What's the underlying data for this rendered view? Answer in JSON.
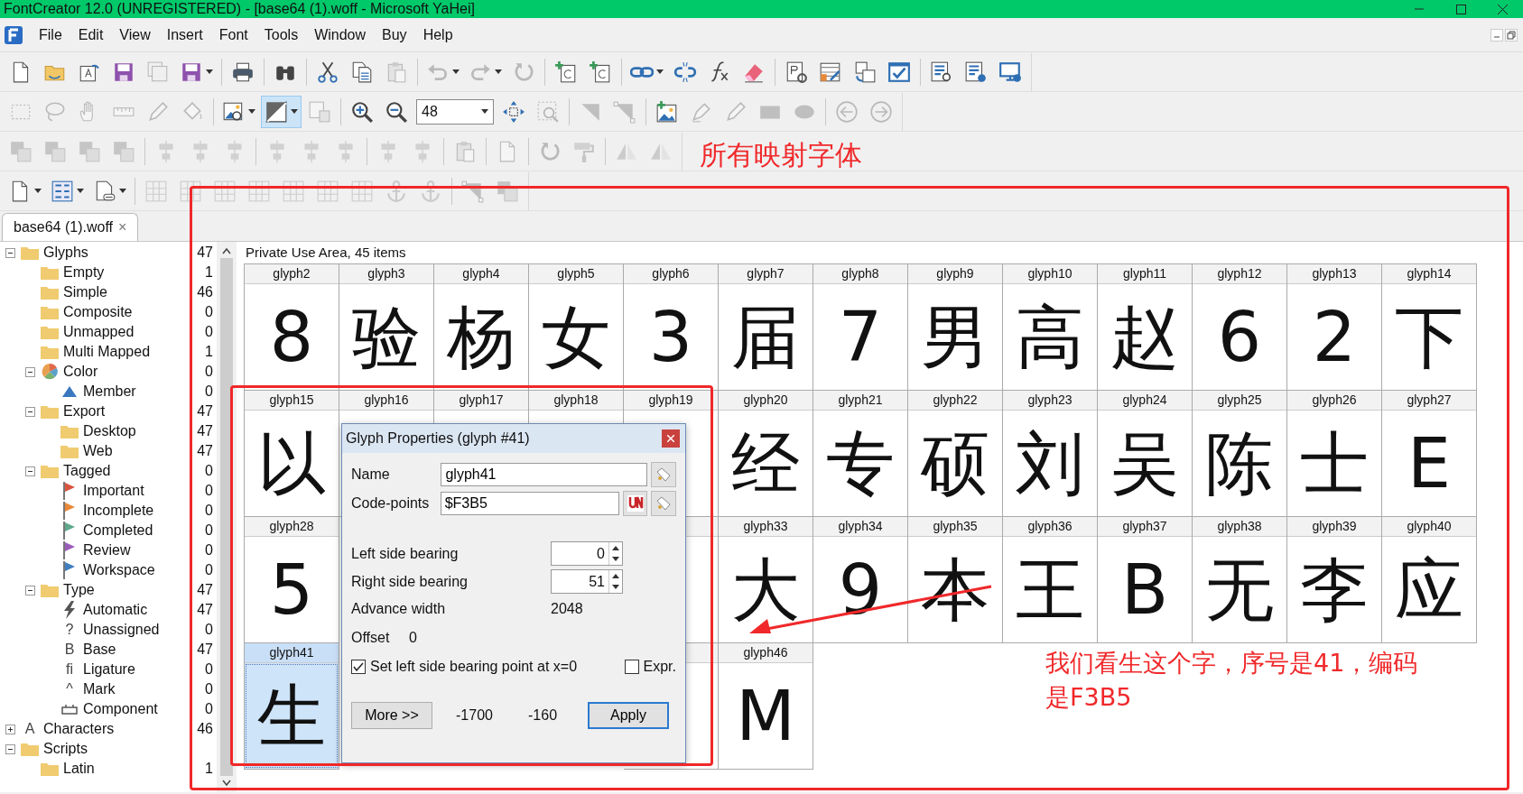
{
  "window": {
    "title": "FontCreator 12.0 (UNREGISTERED) - [base64 (1).woff - Microsoft YaHei]"
  },
  "menu": [
    "File",
    "Edit",
    "View",
    "Insert",
    "Font",
    "Tools",
    "Window",
    "Buy",
    "Help"
  ],
  "toolbars": [
    [
      {
        "kind": "page",
        "disabled": false
      },
      {
        "kind": "folder",
        "disabled": false
      },
      {
        "kind": "preview",
        "disabled": false
      },
      {
        "kind": "floppy",
        "disabled": false
      },
      {
        "kind": "floppies",
        "disabled": true
      },
      {
        "kind": "floppy",
        "disabled": false,
        "dropdown": true
      },
      {
        "kind": "sep"
      },
      {
        "kind": "printer",
        "disabled": false
      },
      {
        "kind": "sep"
      },
      {
        "kind": "binoculars",
        "disabled": false
      },
      {
        "kind": "sep"
      },
      {
        "kind": "scissors",
        "disabled": false
      },
      {
        "kind": "pages",
        "disabled": false
      },
      {
        "kind": "clipboard",
        "disabled": true
      },
      {
        "kind": "sep"
      },
      {
        "kind": "undo",
        "disabled": true,
        "dropdown": true
      },
      {
        "kind": "redo",
        "disabled": true,
        "dropdown": true
      },
      {
        "kind": "reload",
        "disabled": true
      },
      {
        "kind": "sep"
      },
      {
        "kind": "page-plus",
        "disabled": false
      },
      {
        "kind": "page-plus",
        "disabled": false
      },
      {
        "kind": "sep"
      },
      {
        "kind": "chain",
        "disabled": false,
        "dropdown": true
      },
      {
        "kind": "broken-chain",
        "disabled": false
      },
      {
        "kind": "curve",
        "disabled": false
      },
      {
        "kind": "eraser",
        "disabled": false
      },
      {
        "kind": "sep"
      },
      {
        "kind": "page-gear",
        "disabled": false
      },
      {
        "kind": "table-pen",
        "disabled": false
      },
      {
        "kind": "pages-swap",
        "disabled": false
      },
      {
        "kind": "check-window",
        "disabled": false
      },
      {
        "kind": "sep"
      },
      {
        "kind": "doc-lens",
        "disabled": false
      },
      {
        "kind": "doc-globe",
        "disabled": false
      },
      {
        "kind": "monitor",
        "disabled": false
      }
    ],
    [
      {
        "kind": "dashed-rect",
        "disabled": true
      },
      {
        "kind": "lasso",
        "disabled": true
      },
      {
        "kind": "hand",
        "disabled": true
      },
      {
        "kind": "ruler",
        "disabled": true
      },
      {
        "kind": "pencil",
        "disabled": true
      },
      {
        "kind": "bucket",
        "disabled": true
      },
      {
        "kind": "sep"
      },
      {
        "kind": "picture-lens",
        "disabled": false,
        "dropdown": true
      },
      {
        "kind": "contour",
        "disabled": false,
        "dropdown": true,
        "selected": true
      },
      {
        "kind": "shape",
        "disabled": true
      },
      {
        "kind": "sep"
      },
      {
        "kind": "zoom-in",
        "disabled": false
      },
      {
        "kind": "zoom-out",
        "disabled": false
      },
      {
        "kind": "combo",
        "value": "48"
      },
      {
        "kind": "fit",
        "disabled": false
      },
      {
        "kind": "zoom-area",
        "disabled": true
      },
      {
        "kind": "sep"
      },
      {
        "kind": "corner",
        "disabled": true
      },
      {
        "kind": "node",
        "disabled": true
      },
      {
        "kind": "sep"
      },
      {
        "kind": "picture-plus",
        "disabled": false
      },
      {
        "kind": "pen",
        "disabled": true
      },
      {
        "kind": "pencil",
        "disabled": true
      },
      {
        "kind": "rect-shape",
        "disabled": true
      },
      {
        "kind": "ellipse-shape",
        "disabled": true
      },
      {
        "kind": "sep"
      },
      {
        "kind": "arrow-left",
        "disabled": true
      },
      {
        "kind": "arrow-right",
        "disabled": true
      }
    ],
    [
      {
        "kind": "squares",
        "disabled": true
      },
      {
        "kind": "squares",
        "disabled": true
      },
      {
        "kind": "squares",
        "disabled": true
      },
      {
        "kind": "squares",
        "disabled": true
      },
      {
        "kind": "sep"
      },
      {
        "kind": "align",
        "disabled": true
      },
      {
        "kind": "align",
        "disabled": true
      },
      {
        "kind": "align",
        "disabled": true
      },
      {
        "kind": "sep"
      },
      {
        "kind": "align",
        "disabled": true
      },
      {
        "kind": "align",
        "disabled": true
      },
      {
        "kind": "align",
        "disabled": true
      },
      {
        "kind": "sep"
      },
      {
        "kind": "align",
        "disabled": true
      },
      {
        "kind": "align",
        "disabled": true
      },
      {
        "kind": "sep"
      },
      {
        "kind": "clipboard",
        "disabled": true
      },
      {
        "kind": "sep"
      },
      {
        "kind": "page",
        "disabled": true
      },
      {
        "kind": "sep"
      },
      {
        "kind": "reload",
        "disabled": true
      },
      {
        "kind": "roller",
        "disabled": true
      },
      {
        "kind": "sep"
      },
      {
        "kind": "mirror",
        "disabled": true
      },
      {
        "kind": "mirror",
        "disabled": true
      }
    ],
    [
      {
        "kind": "page",
        "disabled": false,
        "dropdown": true
      },
      {
        "kind": "sort",
        "disabled": false,
        "dropdown": true
      },
      {
        "kind": "page-list",
        "disabled": false,
        "dropdown": true
      },
      {
        "kind": "sep"
      },
      {
        "kind": "grid",
        "disabled": true
      },
      {
        "kind": "grid",
        "disabled": true
      },
      {
        "kind": "grid",
        "disabled": true
      },
      {
        "kind": "grid",
        "disabled": true
      },
      {
        "kind": "grid",
        "disabled": true
      },
      {
        "kind": "grid",
        "disabled": true
      },
      {
        "kind": "grid",
        "disabled": true
      },
      {
        "kind": "anchor",
        "disabled": true
      },
      {
        "kind": "anchor",
        "disabled": true
      },
      {
        "kind": "sep"
      },
      {
        "kind": "node",
        "disabled": true
      },
      {
        "kind": "squares",
        "disabled": true
      }
    ]
  ],
  "document_tab": {
    "label": "base64 (1).woff",
    "close": "×"
  },
  "tree": [
    {
      "label": "Glyphs",
      "count": "47",
      "kind": "folder",
      "expanded": true,
      "children": [
        {
          "label": "Empty",
          "count": "1",
          "kind": "folder"
        },
        {
          "label": "Simple",
          "count": "46",
          "kind": "folder"
        },
        {
          "label": "Composite",
          "count": "0",
          "kind": "folder"
        },
        {
          "label": "Unmapped",
          "count": "0",
          "kind": "folder"
        },
        {
          "label": "Multi Mapped",
          "count": "1",
          "kind": "folder"
        },
        {
          "label": "Color",
          "count": "0",
          "kind": "palette",
          "expanded": true,
          "children": [
            {
              "label": "Member",
              "count": "0",
              "kind": "triangle"
            }
          ]
        },
        {
          "label": "Export",
          "count": "47",
          "kind": "folder",
          "expanded": true,
          "children": [
            {
              "label": "Desktop",
              "count": "47",
              "kind": "folder"
            },
            {
              "label": "Web",
              "count": "47",
              "kind": "folder"
            }
          ]
        },
        {
          "label": "Tagged",
          "count": "0",
          "kind": "folder",
          "expanded": true,
          "children": [
            {
              "label": "Important",
              "count": "0",
              "kind": "flag",
              "color": "#d9553f"
            },
            {
              "label": "Incomplete",
              "count": "0",
              "kind": "flag",
              "color": "#e8893a"
            },
            {
              "label": "Completed",
              "count": "0",
              "kind": "flag",
              "color": "#5fa88c"
            },
            {
              "label": "Review",
              "count": "0",
              "kind": "flag",
              "color": "#9b5cb8"
            },
            {
              "label": "Workspace",
              "count": "0",
              "kind": "flag",
              "color": "#3f7fc0"
            }
          ]
        },
        {
          "label": "Type",
          "count": "47",
          "kind": "folder",
          "expanded": true,
          "children": [
            {
              "label": "Automatic",
              "count": "47",
              "kind": "bolt"
            },
            {
              "label": "Unassigned",
              "count": "0",
              "kind": "char",
              "icon_text": "?"
            },
            {
              "label": "Base",
              "count": "47",
              "kind": "char",
              "icon_text": "B"
            },
            {
              "label": "Ligature",
              "count": "0",
              "kind": "char",
              "icon_text": "fi"
            },
            {
              "label": "Mark",
              "count": "0",
              "kind": "char",
              "icon_text": "^"
            },
            {
              "label": "Component",
              "count": "0",
              "kind": "component"
            }
          ]
        }
      ]
    },
    {
      "label": "Characters",
      "count": "46",
      "kind": "char",
      "icon_text": "A",
      "expanded": false
    },
    {
      "label": "Scripts",
      "kind": "folder",
      "expanded": true,
      "children": [
        {
          "label": "Latin",
          "count": "1",
          "kind": "folder"
        }
      ]
    }
  ],
  "grid": {
    "title": "Private Use Area, 45 items",
    "cells": [
      {
        "label": "glyph2",
        "glyph": "8",
        "selected": false
      },
      {
        "label": "glyph3",
        "glyph": "验",
        "selected": false
      },
      {
        "label": "glyph4",
        "glyph": "杨",
        "selected": false
      },
      {
        "label": "glyph5",
        "glyph": "女",
        "selected": false
      },
      {
        "label": "glyph6",
        "glyph": "3",
        "selected": false
      },
      {
        "label": "glyph7",
        "glyph": "届",
        "selected": false
      },
      {
        "label": "glyph8",
        "glyph": "7",
        "selected": false
      },
      {
        "label": "glyph9",
        "glyph": "男",
        "selected": false
      },
      {
        "label": "glyph10",
        "glyph": "高",
        "selected": false
      },
      {
        "label": "glyph11",
        "glyph": "赵",
        "selected": false
      },
      {
        "label": "glyph12",
        "glyph": "6",
        "selected": false
      },
      {
        "label": "glyph13",
        "glyph": "2",
        "selected": false
      },
      {
        "label": "glyph14",
        "glyph": "下",
        "selected": false
      },
      {
        "label": "glyph15",
        "glyph": "以",
        "selected": false
      },
      {
        "label": "glyph16",
        "selected": false
      },
      {
        "label": "glyph17",
        "selected": false
      },
      {
        "label": "glyph18",
        "selected": false
      },
      {
        "label": "glyph19",
        "selected": false
      },
      {
        "label": "glyph20",
        "glyph": "经",
        "selected": false
      },
      {
        "label": "glyph21",
        "glyph": "专",
        "selected": false
      },
      {
        "label": "glyph22",
        "glyph": "硕",
        "selected": false
      },
      {
        "label": "glyph23",
        "glyph": "刘",
        "selected": false
      },
      {
        "label": "glyph24",
        "glyph": "吴",
        "selected": false
      },
      {
        "label": "glyph25",
        "glyph": "陈",
        "selected": false
      },
      {
        "label": "glyph26",
        "glyph": "士",
        "selected": false
      },
      {
        "label": "glyph27",
        "glyph": "E",
        "selected": false
      },
      {
        "label": "glyph28",
        "glyph": "5",
        "selected": false
      },
      {},
      {},
      {},
      {
        "selected": false
      },
      {
        "label": "glyph33",
        "glyph": "大",
        "selected": false
      },
      {
        "label": "glyph34",
        "glyph": "9",
        "selected": false
      },
      {
        "label": "glyph35",
        "glyph": "本",
        "selected": false
      },
      {
        "label": "glyph36",
        "glyph": "王",
        "selected": false
      },
      {
        "label": "glyph37",
        "glyph": "B",
        "selected": false
      },
      {
        "label": "glyph38",
        "glyph": "无",
        "selected": false
      },
      {
        "label": "glyph39",
        "glyph": "李",
        "selected": false
      },
      {
        "label": "glyph40",
        "glyph": "应",
        "selected": false
      },
      {
        "label": "glyph41",
        "glyph": "生",
        "selected": true
      },
      {},
      {},
      {},
      {
        "selected": false
      },
      {
        "label": "glyph46",
        "glyph": "M",
        "selected": false
      }
    ]
  },
  "dialog": {
    "title": "Glyph Properties (glyph #41)",
    "name_label": "Name",
    "name_value": "glyph41",
    "codepoints_label": "Code-points",
    "codepoints_value": "$F3B5",
    "lsb_label": "Left side bearing",
    "lsb_value": "0",
    "rsb_label": "Right side bearing",
    "rsb_value": "51",
    "advance_label": "Advance width",
    "advance_value": "2048",
    "offset_label": "Offset",
    "offset_value": "0",
    "set_lsb": {
      "label": "Set left side bearing point at x=0",
      "checked": true
    },
    "expr": {
      "label": "Expr.",
      "checked": false
    },
    "more_button": "More >>",
    "value_1": "-1700",
    "value_2": "-160",
    "apply_button": "Apply"
  },
  "annotations": {
    "heading": "所有映射字体",
    "note": [
      "我们看生这个字，序号是41，编码",
      "是F3B5"
    ]
  }
}
